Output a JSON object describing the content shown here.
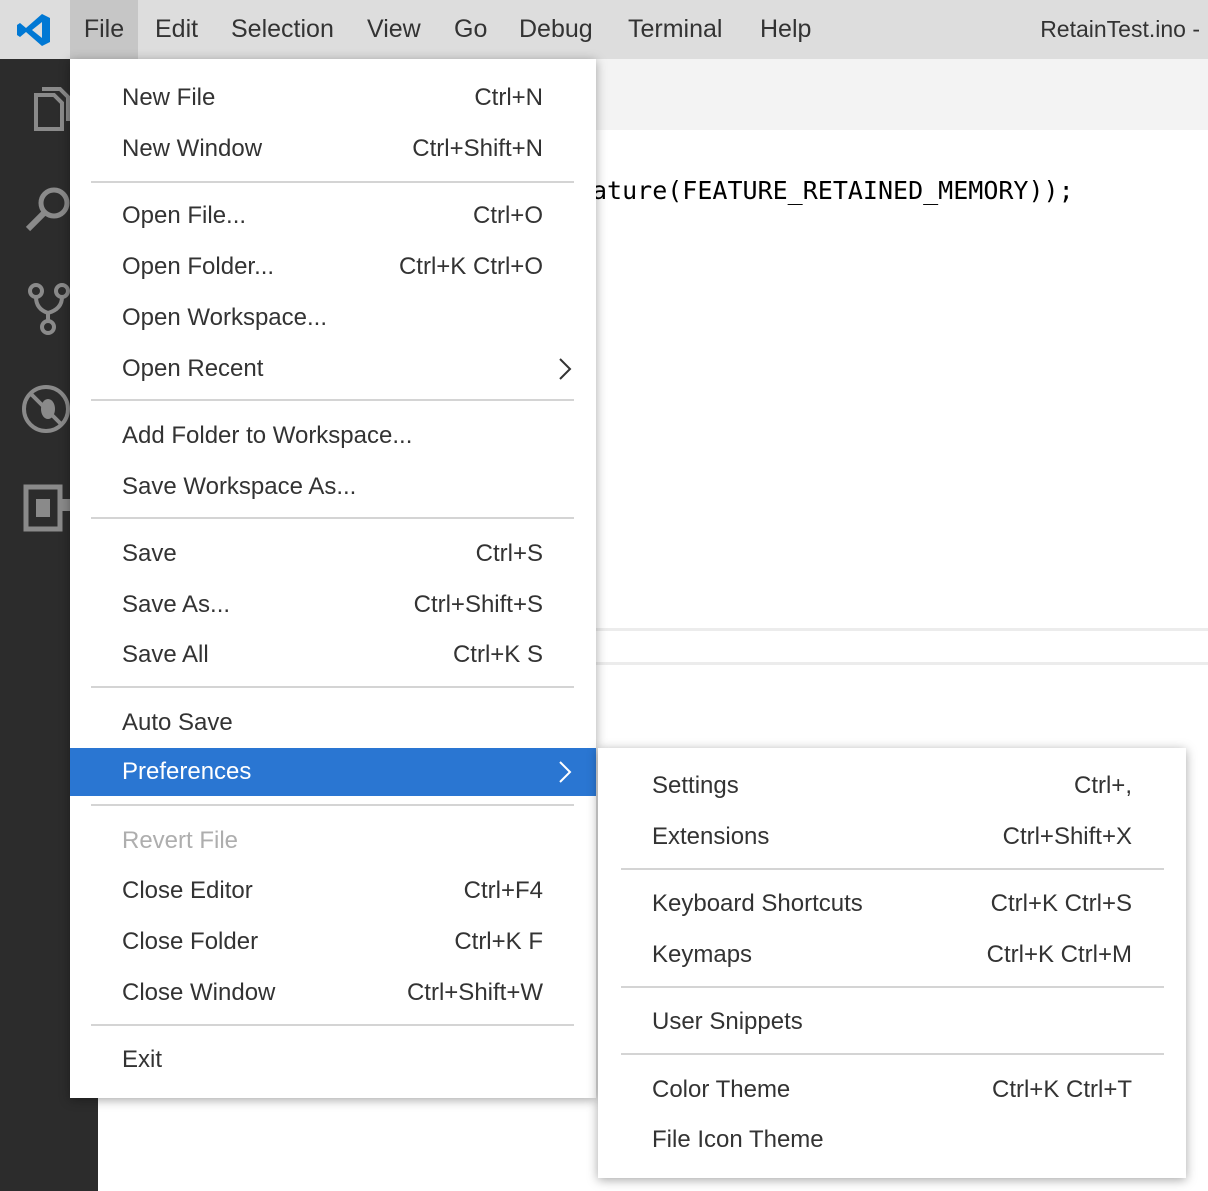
{
  "menubar": {
    "items": [
      "File",
      "Edit",
      "Selection",
      "View",
      "Go",
      "Debug",
      "Terminal",
      "Help"
    ],
    "window_title": "RetainTest.ino -"
  },
  "editor": {
    "code_line": "ature(FEATURE_RETAINED_MEMORY));"
  },
  "file_menu": {
    "items": [
      {
        "label": "New File",
        "shortcut": "Ctrl+N"
      },
      {
        "label": "New Window",
        "shortcut": "Ctrl+Shift+N"
      },
      {
        "label": "Open File...",
        "shortcut": "Ctrl+O"
      },
      {
        "label": "Open Folder...",
        "shortcut": "Ctrl+K Ctrl+O"
      },
      {
        "label": "Open Workspace...",
        "shortcut": ""
      },
      {
        "label": "Open Recent",
        "shortcut": ""
      },
      {
        "label": "Add Folder to Workspace...",
        "shortcut": ""
      },
      {
        "label": "Save Workspace As...",
        "shortcut": ""
      },
      {
        "label": "Save",
        "shortcut": "Ctrl+S"
      },
      {
        "label": "Save As...",
        "shortcut": "Ctrl+Shift+S"
      },
      {
        "label": "Save All",
        "shortcut": "Ctrl+K S"
      },
      {
        "label": "Auto Save",
        "shortcut": ""
      },
      {
        "label": "Preferences",
        "shortcut": ""
      },
      {
        "label": "Revert File",
        "shortcut": ""
      },
      {
        "label": "Close Editor",
        "shortcut": "Ctrl+F4"
      },
      {
        "label": "Close Folder",
        "shortcut": "Ctrl+K F"
      },
      {
        "label": "Close Window",
        "shortcut": "Ctrl+Shift+W"
      },
      {
        "label": "Exit",
        "shortcut": ""
      }
    ]
  },
  "preferences_menu": {
    "items": [
      {
        "label": "Settings",
        "shortcut": "Ctrl+,"
      },
      {
        "label": "Extensions",
        "shortcut": "Ctrl+Shift+X"
      },
      {
        "label": "Keyboard Shortcuts",
        "shortcut": "Ctrl+K Ctrl+S"
      },
      {
        "label": "Keymaps",
        "shortcut": "Ctrl+K Ctrl+M"
      },
      {
        "label": "User Snippets",
        "shortcut": ""
      },
      {
        "label": "Color Theme",
        "shortcut": "Ctrl+K Ctrl+T"
      },
      {
        "label": "File Icon Theme",
        "shortcut": ""
      }
    ]
  },
  "activity_bar": {
    "icons": [
      "explorer-icon",
      "search-icon",
      "source-control-icon",
      "debug-icon",
      "extensions-icon"
    ]
  },
  "colors": {
    "menubar_bg": "#dddddd",
    "activity_bar_bg": "#2c2c2c",
    "selection_bg": "#2a76d2",
    "logo_blue": "#0078d4"
  }
}
